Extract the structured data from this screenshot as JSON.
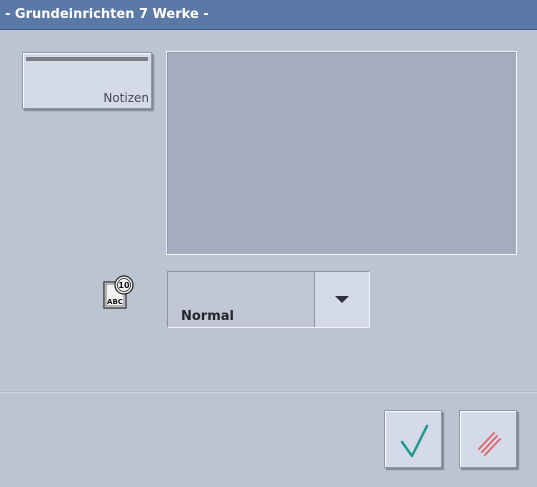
{
  "window": {
    "title": "- Grundeinrichten 7 Werke -"
  },
  "notes_button": {
    "label": "Notizen"
  },
  "notes_area": {
    "value": ""
  },
  "font_icon": {
    "icon": "font-settings-icon",
    "text": "ABC",
    "badge": "10"
  },
  "font_select": {
    "selected": "Normal"
  },
  "actions": {
    "ok_icon": "checkmark-icon",
    "cancel_icon": "cancel-icon"
  },
  "colors": {
    "titlebar": "#5b79a6",
    "background": "#bcc4d2",
    "button_face": "#d4daea",
    "checkmark": "#1a9a86",
    "cancel": "#e06a6a"
  }
}
